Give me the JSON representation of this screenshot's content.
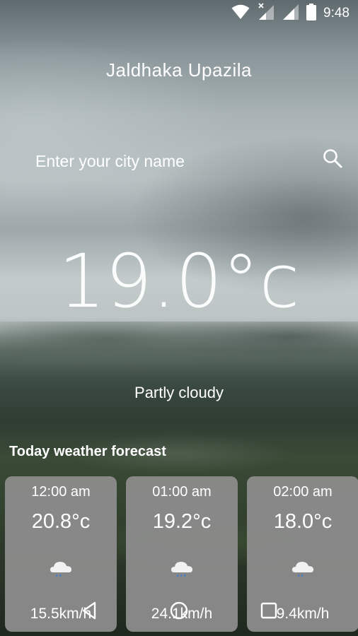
{
  "status_bar": {
    "time": "9:48",
    "icons": [
      "wifi-icon",
      "mobile-data-icon",
      "signal-icon",
      "battery-icon"
    ]
  },
  "location": {
    "city": "Jaldhaka Upazila"
  },
  "search": {
    "placeholder": "Enter your city name",
    "value": "",
    "icon": "search-icon"
  },
  "current": {
    "temperature": "19.0°c",
    "condition": "Partly cloudy"
  },
  "forecast": {
    "title": "Today weather forecast",
    "items": [
      {
        "time": "12:00 am",
        "temp": "20.8°c",
        "icon": "night-cloudy-rain-icon",
        "wind": "15.5km/h"
      },
      {
        "time": "01:00 am",
        "temp": "19.2°c",
        "icon": "cloudy-rain-icon",
        "wind": "24.1km/h"
      },
      {
        "time": "02:00 am",
        "temp": "18.0°c",
        "icon": "night-cloudy-rain-icon",
        "wind": "9.4km/h"
      }
    ]
  },
  "navigation": {
    "buttons": [
      "back-icon",
      "home-icon",
      "recents-icon"
    ]
  },
  "colors": {
    "card_background": "#8e8e8e",
    "text": "#ffffff"
  }
}
